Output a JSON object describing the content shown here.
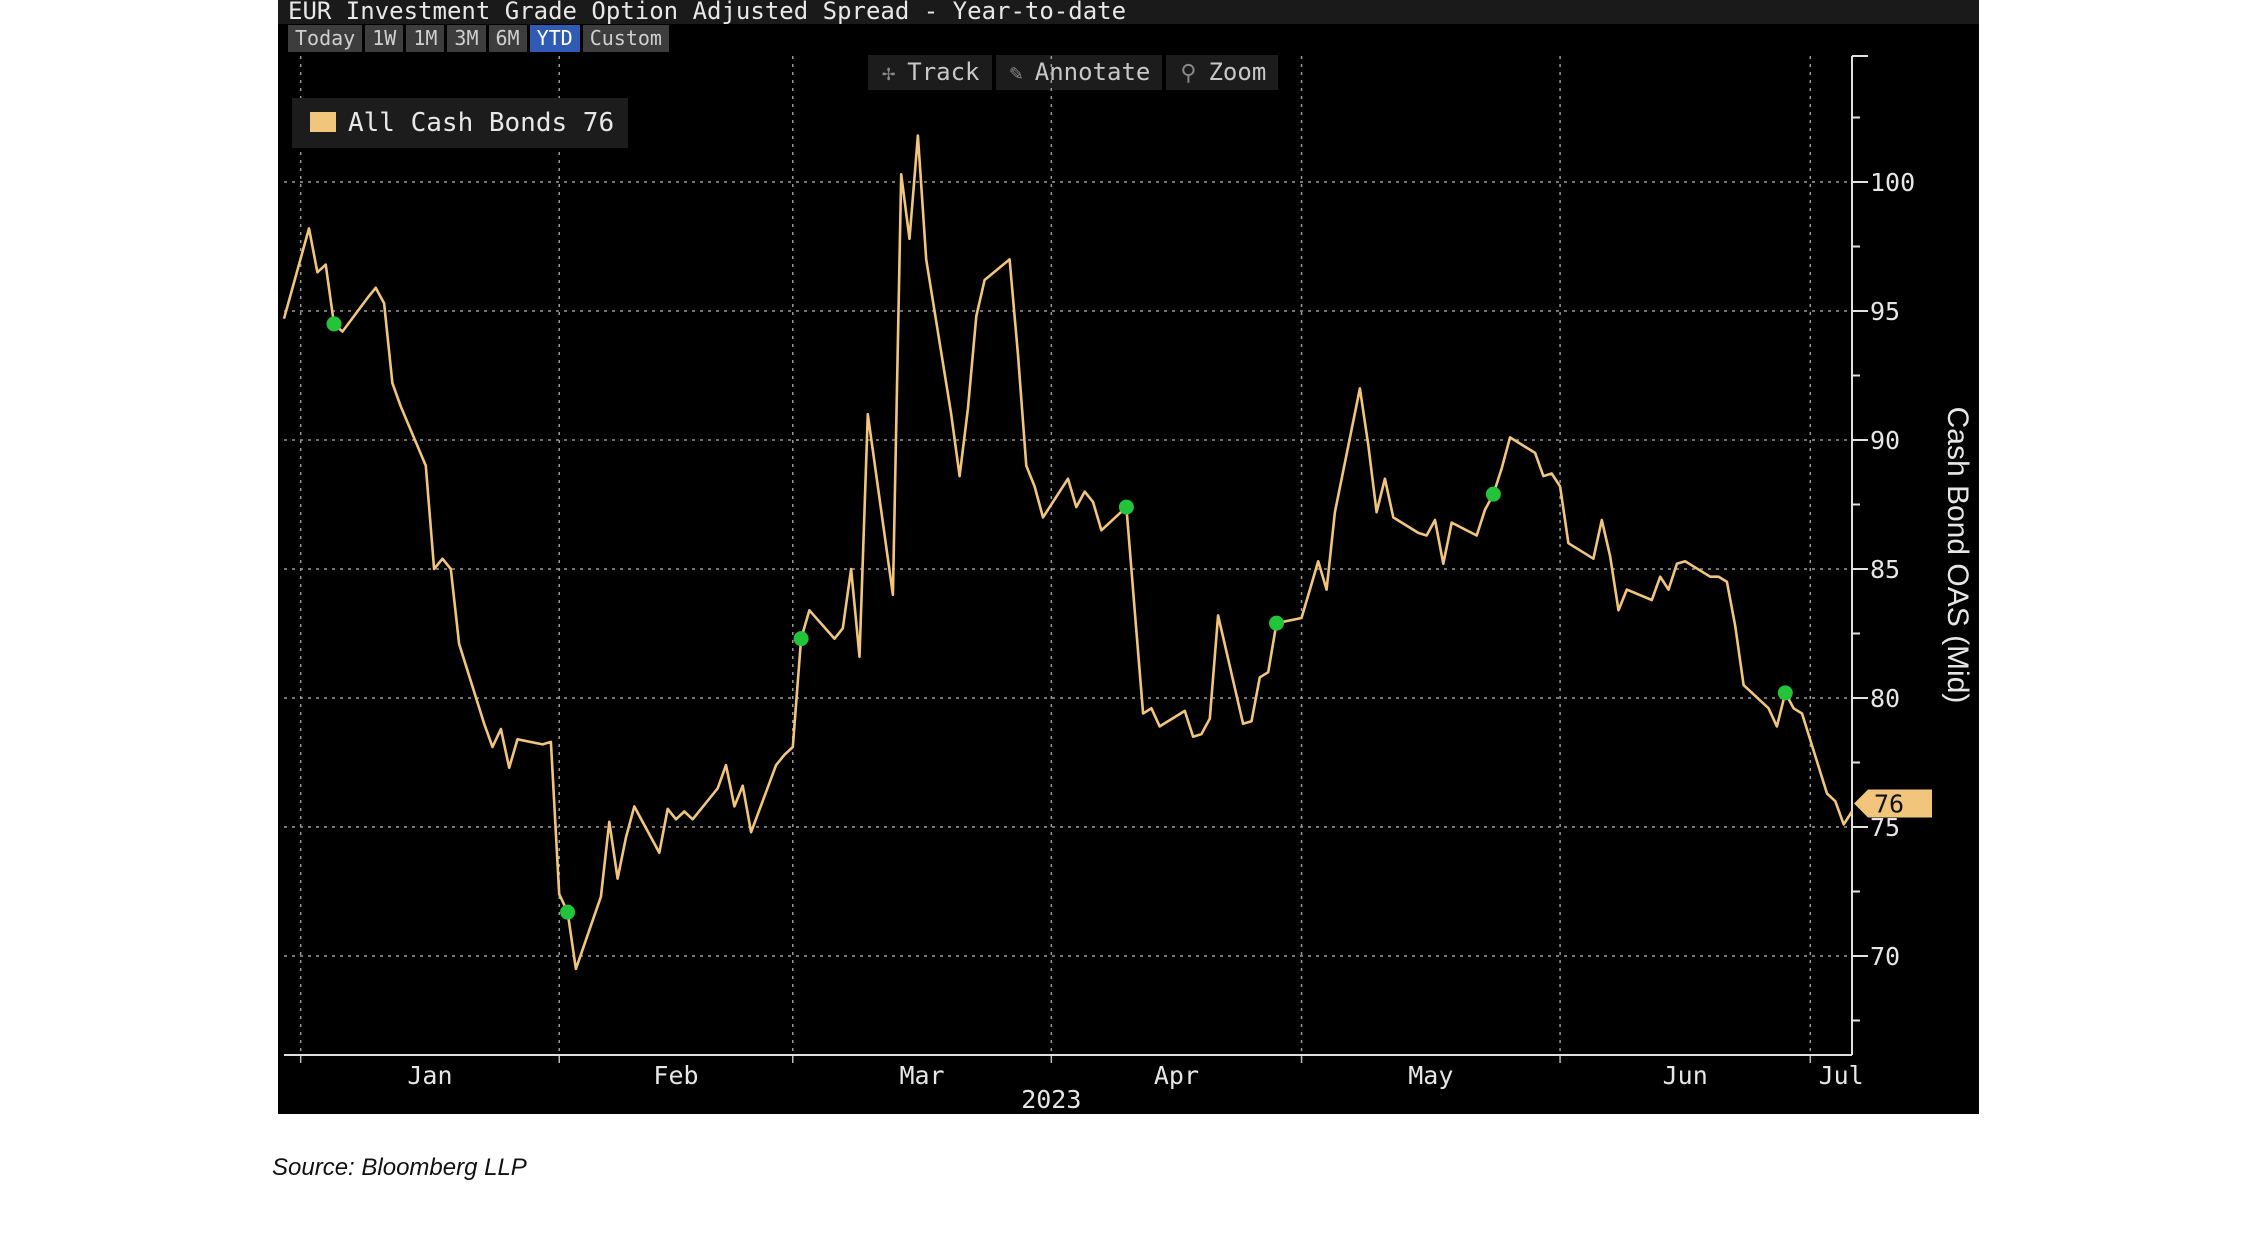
{
  "title": "EUR Investment Grade Option Adjusted Spread - Year-to-date",
  "ranges": [
    {
      "label": "Today",
      "active": false
    },
    {
      "label": "1W",
      "active": false
    },
    {
      "label": "1M",
      "active": false
    },
    {
      "label": "3M",
      "active": false
    },
    {
      "label": "6M",
      "active": false
    },
    {
      "label": "YTD",
      "active": true
    },
    {
      "label": "Custom",
      "active": false
    }
  ],
  "toolbar": {
    "track": "Track",
    "annotate": "Annotate",
    "zoom": "Zoom"
  },
  "legend": {
    "label": "All Cash Bonds 76"
  },
  "source": "Source: Bloomberg LLP",
  "colors": {
    "line": "#f2c57c",
    "marker": "#22c43a",
    "background": "#000000",
    "active_range": "#2f5bb5"
  },
  "chart_data": {
    "type": "line",
    "ylabel": "Cash Bond OAS (Mid)",
    "ylim": [
      66,
      105
    ],
    "yticks": [
      70,
      75,
      80,
      85,
      90,
      95,
      100
    ],
    "y_tick_labels": [
      "70",
      "75",
      "80",
      "85",
      "90",
      "95",
      "100"
    ],
    "x_month_labels": [
      "Jan",
      "Feb",
      "Mar",
      "Apr",
      "May",
      "Jun",
      "Jul"
    ],
    "x_year_label": "2023",
    "last_value_label": "76",
    "x_start": "2022-12-30",
    "x_end": "2023-07-06",
    "series": [
      {
        "name": "All Cash Bonds",
        "points": [
          [
            "2022-12-30",
            94.7
          ],
          [
            "2023-01-02",
            98.2
          ],
          [
            "2023-01-03",
            96.5
          ],
          [
            "2023-01-04",
            96.8
          ],
          [
            "2023-01-05",
            94.5
          ],
          [
            "2023-01-06",
            94.2
          ],
          [
            "2023-01-09",
            95.5
          ],
          [
            "2023-01-10",
            95.9
          ],
          [
            "2023-01-11",
            95.3
          ],
          [
            "2023-01-12",
            92.2
          ],
          [
            "2023-01-13",
            91.3
          ],
          [
            "2023-01-16",
            89.0
          ],
          [
            "2023-01-17",
            85.0
          ],
          [
            "2023-01-18",
            85.4
          ],
          [
            "2023-01-19",
            85.0
          ],
          [
            "2023-01-20",
            82.1
          ],
          [
            "2023-01-23",
            79.0
          ],
          [
            "2023-01-24",
            78.1
          ],
          [
            "2023-01-25",
            78.8
          ],
          [
            "2023-01-26",
            77.3
          ],
          [
            "2023-01-27",
            78.4
          ],
          [
            "2023-01-30",
            78.2
          ],
          [
            "2023-01-31",
            78.3
          ],
          [
            "2023-02-01",
            72.4
          ],
          [
            "2023-02-02",
            71.7
          ],
          [
            "2023-02-03",
            69.5
          ],
          [
            "2023-02-06",
            72.3
          ],
          [
            "2023-02-07",
            75.2
          ],
          [
            "2023-02-08",
            73.0
          ],
          [
            "2023-02-09",
            74.6
          ],
          [
            "2023-02-10",
            75.8
          ],
          [
            "2023-02-13",
            74.0
          ],
          [
            "2023-02-14",
            75.7
          ],
          [
            "2023-02-15",
            75.3
          ],
          [
            "2023-02-16",
            75.6
          ],
          [
            "2023-02-17",
            75.3
          ],
          [
            "2023-02-20",
            76.5
          ],
          [
            "2023-02-21",
            77.4
          ],
          [
            "2023-02-22",
            75.8
          ],
          [
            "2023-02-23",
            76.6
          ],
          [
            "2023-02-24",
            74.8
          ],
          [
            "2023-02-27",
            77.4
          ],
          [
            "2023-02-28",
            77.8
          ],
          [
            "2023-03-01",
            78.1
          ],
          [
            "2023-03-02",
            82.3
          ],
          [
            "2023-03-03",
            83.4
          ],
          [
            "2023-03-06",
            82.3
          ],
          [
            "2023-03-07",
            82.7
          ],
          [
            "2023-03-08",
            85.0
          ],
          [
            "2023-03-09",
            81.6
          ],
          [
            "2023-03-10",
            91.0
          ],
          [
            "2023-03-13",
            84.0
          ],
          [
            "2023-03-14",
            100.3
          ],
          [
            "2023-03-15",
            97.8
          ],
          [
            "2023-03-16",
            101.8
          ],
          [
            "2023-03-17",
            97.0
          ],
          [
            "2023-03-20",
            91.0
          ],
          [
            "2023-03-21",
            88.6
          ],
          [
            "2023-03-22",
            91.2
          ],
          [
            "2023-03-23",
            94.8
          ],
          [
            "2023-03-24",
            96.2
          ],
          [
            "2023-03-27",
            97.0
          ],
          [
            "2023-03-28",
            93.3
          ],
          [
            "2023-03-29",
            89.0
          ],
          [
            "2023-03-30",
            88.2
          ],
          [
            "2023-03-31",
            87.0
          ],
          [
            "2023-04-03",
            88.5
          ],
          [
            "2023-04-04",
            87.4
          ],
          [
            "2023-04-05",
            88.0
          ],
          [
            "2023-04-06",
            87.6
          ],
          [
            "2023-04-07",
            86.5
          ],
          [
            "2023-04-10",
            87.4
          ],
          [
            "2023-04-11",
            83.4
          ],
          [
            "2023-04-12",
            79.4
          ],
          [
            "2023-04-13",
            79.6
          ],
          [
            "2023-04-14",
            78.9
          ],
          [
            "2023-04-17",
            79.5
          ],
          [
            "2023-04-18",
            78.5
          ],
          [
            "2023-04-19",
            78.6
          ],
          [
            "2023-04-20",
            79.2
          ],
          [
            "2023-04-21",
            83.2
          ],
          [
            "2023-04-24",
            79.0
          ],
          [
            "2023-04-25",
            79.1
          ],
          [
            "2023-04-26",
            80.8
          ],
          [
            "2023-04-27",
            81.0
          ],
          [
            "2023-04-28",
            82.9
          ],
          [
            "2023-05-01",
            83.1
          ],
          [
            "2023-05-02",
            84.2
          ],
          [
            "2023-05-03",
            85.3
          ],
          [
            "2023-05-04",
            84.2
          ],
          [
            "2023-05-05",
            87.2
          ],
          [
            "2023-05-08",
            92.0
          ],
          [
            "2023-05-09",
            89.8
          ],
          [
            "2023-05-10",
            87.2
          ],
          [
            "2023-05-11",
            88.5
          ],
          [
            "2023-05-12",
            87.0
          ],
          [
            "2023-05-15",
            86.4
          ],
          [
            "2023-05-16",
            86.3
          ],
          [
            "2023-05-17",
            86.9
          ],
          [
            "2023-05-18",
            85.2
          ],
          [
            "2023-05-19",
            86.8
          ],
          [
            "2023-05-22",
            86.3
          ],
          [
            "2023-05-23",
            87.3
          ],
          [
            "2023-05-24",
            87.9
          ],
          [
            "2023-05-25",
            88.9
          ],
          [
            "2023-05-26",
            90.1
          ],
          [
            "2023-05-29",
            89.5
          ],
          [
            "2023-05-30",
            88.6
          ],
          [
            "2023-05-31",
            88.7
          ],
          [
            "2023-06-01",
            88.2
          ],
          [
            "2023-06-02",
            86.0
          ],
          [
            "2023-06-05",
            85.4
          ],
          [
            "2023-06-06",
            86.9
          ],
          [
            "2023-06-07",
            85.5
          ],
          [
            "2023-06-08",
            83.4
          ],
          [
            "2023-06-09",
            84.2
          ],
          [
            "2023-06-12",
            83.8
          ],
          [
            "2023-06-13",
            84.7
          ],
          [
            "2023-06-14",
            84.2
          ],
          [
            "2023-06-15",
            85.2
          ],
          [
            "2023-06-16",
            85.3
          ],
          [
            "2023-06-19",
            84.7
          ],
          [
            "2023-06-20",
            84.7
          ],
          [
            "2023-06-21",
            84.5
          ],
          [
            "2023-06-22",
            82.8
          ],
          [
            "2023-06-23",
            80.5
          ],
          [
            "2023-06-26",
            79.6
          ],
          [
            "2023-06-27",
            78.9
          ],
          [
            "2023-06-28",
            80.2
          ],
          [
            "2023-06-29",
            79.6
          ],
          [
            "2023-06-30",
            79.4
          ],
          [
            "2023-07-03",
            76.3
          ],
          [
            "2023-07-04",
            76.0
          ],
          [
            "2023-07-05",
            75.1
          ],
          [
            "2023-07-06",
            75.6
          ]
        ]
      }
    ],
    "markers": [
      [
        "2023-01-05",
        94.5
      ],
      [
        "2023-02-02",
        71.7
      ],
      [
        "2023-03-02",
        82.3
      ],
      [
        "2023-04-10",
        87.4
      ],
      [
        "2023-04-28",
        82.9
      ],
      [
        "2023-05-24",
        87.9
      ],
      [
        "2023-06-28",
        80.2
      ]
    ]
  }
}
